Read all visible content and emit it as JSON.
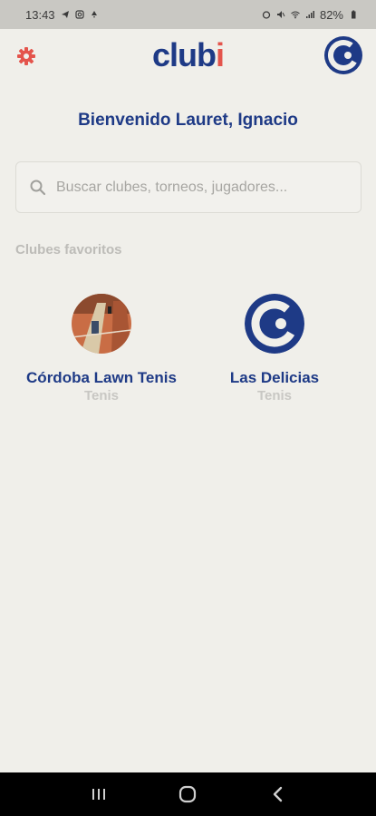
{
  "status_bar": {
    "time": "13:43",
    "battery": "82%"
  },
  "header": {
    "logo_main": "club",
    "logo_accent": "i",
    "settings_icon": "gear-icon",
    "brand_icon": "clubi-logo-icon"
  },
  "welcome": "Bienvenido Lauret, Ignacio",
  "search": {
    "placeholder": "Buscar clubes, torneos, jugadores..."
  },
  "favorites": {
    "title": "Clubes favoritos",
    "clubs": [
      {
        "name": "Córdoba Lawn Tenis",
        "sport": "Tenis"
      },
      {
        "name": "Las Delicias",
        "sport": "Tenis"
      }
    ]
  },
  "colors": {
    "brand_blue": "#1e3a86",
    "accent_red": "#e4544c",
    "background": "#f0efea"
  }
}
